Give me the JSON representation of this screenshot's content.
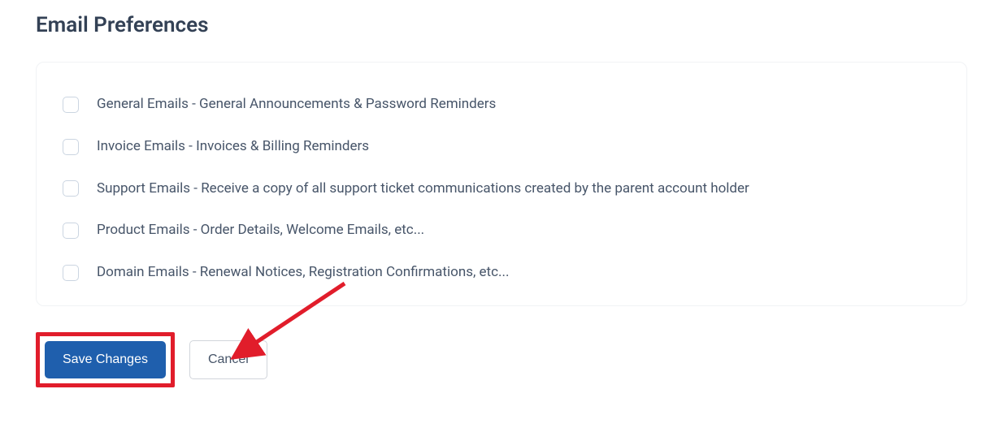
{
  "section": {
    "title": "Email Preferences",
    "options": [
      {
        "label": "General Emails - General Announcements & Password Reminders"
      },
      {
        "label": "Invoice Emails - Invoices & Billing Reminders"
      },
      {
        "label": "Support Emails - Receive a copy of all support ticket communications created by the parent account holder"
      },
      {
        "label": "Product Emails - Order Details, Welcome Emails, etc..."
      },
      {
        "label": "Domain Emails - Renewal Notices, Registration Confirmations, etc..."
      }
    ]
  },
  "buttons": {
    "save": "Save Changes",
    "cancel": "Cancel"
  },
  "annotation": {
    "highlight_color": "#e11d2b",
    "arrow_color": "#e11d2b"
  }
}
